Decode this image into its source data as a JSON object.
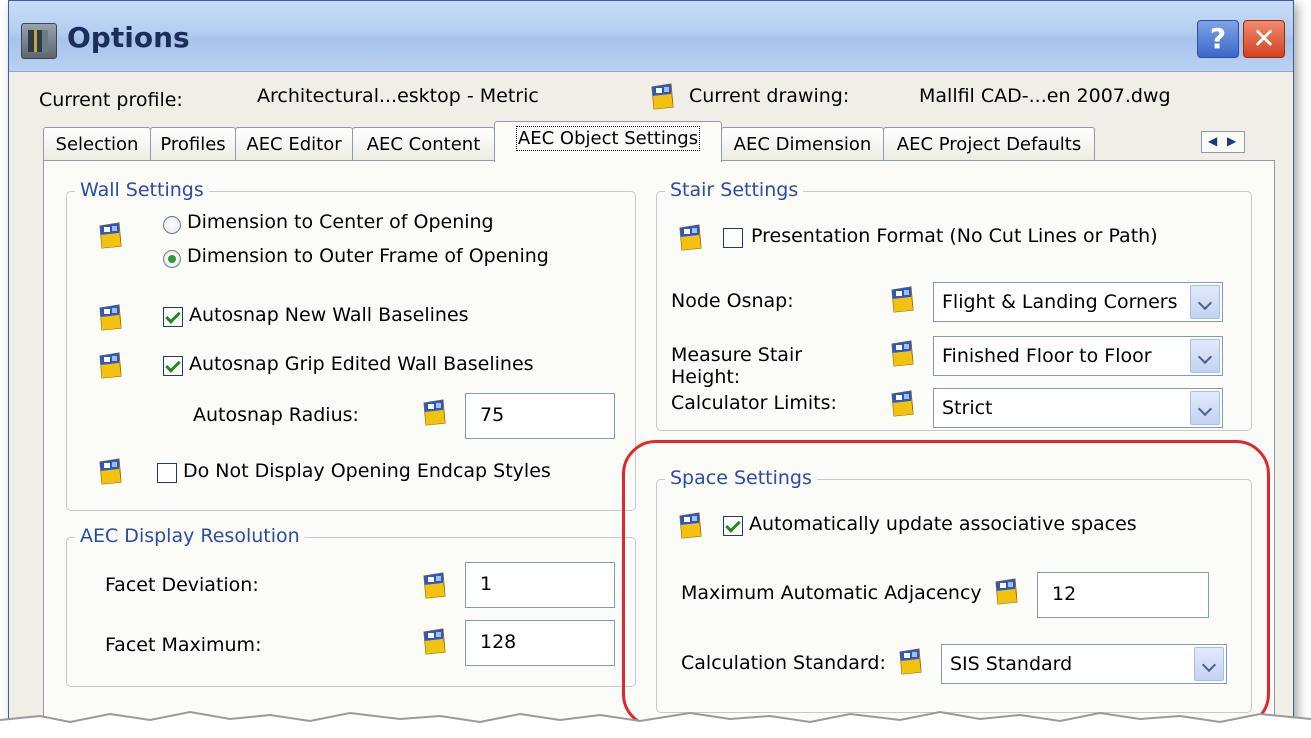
{
  "window": {
    "title": "Options",
    "help_label": "?",
    "close_label": "✕"
  },
  "profile": {
    "current_profile_label": "Current profile:",
    "current_profile_value": "Architectural...esktop - Metric",
    "current_drawing_label": "Current drawing:",
    "current_drawing_value": "Mallfil CAD-...en 2007.dwg"
  },
  "tabs": [
    {
      "label": "Selection"
    },
    {
      "label": "Profiles"
    },
    {
      "label": "AEC Editor"
    },
    {
      "label": "AEC Content"
    },
    {
      "label": "AEC Object Settings"
    },
    {
      "label": "AEC Dimension"
    },
    {
      "label": "AEC Project Defaults"
    }
  ],
  "active_tab": "AEC Object Settings",
  "wall_settings": {
    "title": "Wall Settings",
    "radio_center": "Dimension to Center of Opening",
    "radio_outer": "Dimension to Outer Frame of Opening",
    "selected_radio": "Dimension to Outer Frame of Opening",
    "autosnap_new": {
      "label": "Autosnap New Wall Baselines",
      "checked": true
    },
    "autosnap_grip": {
      "label": "Autosnap Grip Edited Wall Baselines",
      "checked": true
    },
    "autosnap_radius_label": "Autosnap Radius:",
    "autosnap_radius_value": "75",
    "no_endcap": {
      "label": "Do Not Display Opening Endcap Styles",
      "checked": false
    }
  },
  "display_resolution": {
    "title": "AEC Display Resolution",
    "facet_deviation_label": "Facet Deviation:",
    "facet_deviation_value": "1",
    "facet_maximum_label": "Facet Maximum:",
    "facet_maximum_value": "128"
  },
  "stair_settings": {
    "title": "Stair Settings",
    "presentation": {
      "label": "Presentation Format (No Cut Lines or Path)",
      "checked": false
    },
    "node_osnap_label": "Node Osnap:",
    "node_osnap_value": "Flight & Landing Corners",
    "measure_height_label_1": "Measure Stair",
    "measure_height_label_2": "Height:",
    "measure_height_value": "Finished Floor to Floor",
    "calculator_limits_label": "Calculator Limits:",
    "calculator_limits_value": "Strict"
  },
  "space_settings": {
    "title": "Space Settings",
    "auto_update": {
      "label": "Automatically update associative spaces",
      "checked": true
    },
    "max_adjacency_label": "Maximum Automatic Adjacency",
    "max_adjacency_value": "12",
    "calc_standard_label": "Calculation Standard:",
    "calc_standard_value": "SIS Standard"
  },
  "colors": {
    "title_text": "#1c2d5c",
    "group_title": "#2a4da0",
    "highlight": "#e0282e",
    "check_mark": "#1f8a1f"
  }
}
